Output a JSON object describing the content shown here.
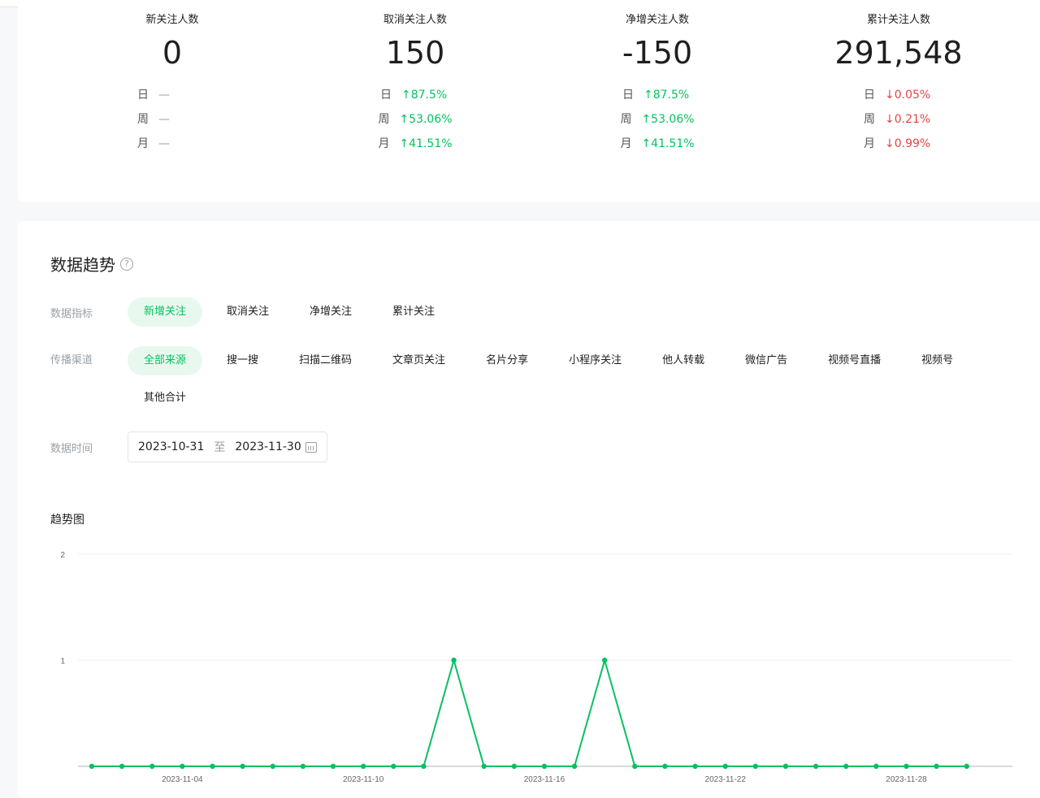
{
  "stats": [
    {
      "title": "新关注人数",
      "value": "0",
      "rows": [
        {
          "label": "日",
          "value": "—",
          "trend": "none"
        },
        {
          "label": "周",
          "value": "—",
          "trend": "none"
        },
        {
          "label": "月",
          "value": "—",
          "trend": "none"
        }
      ]
    },
    {
      "title": "取消关注人数",
      "value": "150",
      "rows": [
        {
          "label": "日",
          "value": "↑87.5%",
          "trend": "up"
        },
        {
          "label": "周",
          "value": "↑53.06%",
          "trend": "up"
        },
        {
          "label": "月",
          "value": "↑41.51%",
          "trend": "up"
        }
      ]
    },
    {
      "title": "净增关注人数",
      "value": "-150",
      "rows": [
        {
          "label": "日",
          "value": "↑87.5%",
          "trend": "up"
        },
        {
          "label": "周",
          "value": "↑53.06%",
          "trend": "up"
        },
        {
          "label": "月",
          "value": "↑41.51%",
          "trend": "up"
        }
      ]
    },
    {
      "title": "累计关注人数",
      "value": "291,548",
      "rows": [
        {
          "label": "日",
          "value": "↓0.05%",
          "trend": "down"
        },
        {
          "label": "周",
          "value": "↓0.21%",
          "trend": "down"
        },
        {
          "label": "月",
          "value": "↓0.99%",
          "trend": "down"
        }
      ]
    }
  ],
  "trend": {
    "title": "数据趋势",
    "help_icon": "question-circle-icon",
    "metric_label": "数据指标",
    "metrics": [
      "新增关注",
      "取消关注",
      "净增关注",
      "累计关注"
    ],
    "metric_active": 0,
    "channel_label": "传播渠道",
    "channels": [
      "全部来源",
      "搜一搜",
      "扫描二维码",
      "文章页关注",
      "名片分享",
      "小程序关注",
      "他人转载",
      "微信广告",
      "视频号直播",
      "视频号",
      "其他合计"
    ],
    "channel_active": 0,
    "time_label": "数据时间",
    "date_start": "2023-10-31",
    "date_sep": "至",
    "date_end": "2023-11-30",
    "calendar_icon": "calendar-icon",
    "chart_title": "趋势图"
  },
  "colors": {
    "accent": "#07c160",
    "up": "#07c160",
    "down": "#e54545",
    "muted": "#9aa0a6"
  },
  "chart_data": {
    "type": "line",
    "x": [
      "2023-11-01",
      "2023-11-02",
      "2023-11-03",
      "2023-11-04",
      "2023-11-05",
      "2023-11-06",
      "2023-11-07",
      "2023-11-08",
      "2023-11-09",
      "2023-11-10",
      "2023-11-11",
      "2023-11-12",
      "2023-11-13",
      "2023-11-14",
      "2023-11-15",
      "2023-11-16",
      "2023-11-17",
      "2023-11-18",
      "2023-11-19",
      "2023-11-20",
      "2023-11-21",
      "2023-11-22",
      "2023-11-23",
      "2023-11-24",
      "2023-11-25",
      "2023-11-26",
      "2023-11-27",
      "2023-11-28",
      "2023-11-29",
      "2023-11-30"
    ],
    "series": [
      {
        "values": [
          0,
          0,
          0,
          0,
          0,
          0,
          0,
          0,
          0,
          0,
          0,
          0,
          1,
          0,
          0,
          0,
          0,
          1,
          0,
          0,
          0,
          0,
          0,
          0,
          0,
          0,
          0,
          0,
          0,
          0
        ]
      }
    ],
    "xticks": [
      "2023-11-04",
      "2023-11-10",
      "2023-11-16",
      "2023-11-22",
      "2023-11-28"
    ],
    "yticks": [
      1,
      2
    ],
    "ylim": [
      0,
      2
    ],
    "grid": true,
    "color": "#07c160"
  }
}
